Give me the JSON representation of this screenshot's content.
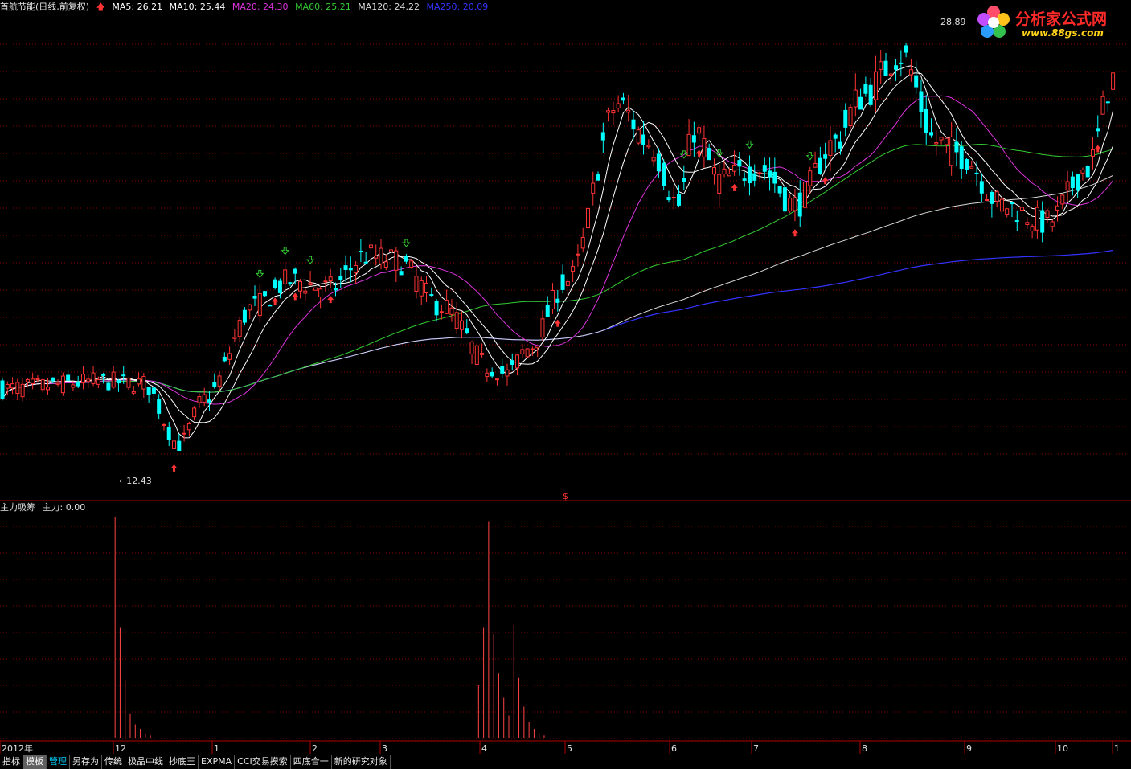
{
  "header": {
    "title": "首航节能(日线,前复权)",
    "ma5": "MA5: 26.21",
    "ma10": "MA10: 25.44",
    "ma20": "MA20: 24.30",
    "ma60": "MA60: 25.21",
    "ma120": "MA120: 24.22",
    "ma250": "MA250: 20.09"
  },
  "colors": {
    "ma5": "#ffffff",
    "ma10": "#ffffff",
    "ma20": "#dd33dd",
    "ma60": "#33cc33",
    "ma120": "#d8d8d8",
    "ma250": "#3333ff",
    "up": "#ff3333",
    "down": "#00ffff",
    "grid": "#8b0000"
  },
  "annotations": {
    "high": "28.89",
    "low": "12.43",
    "marker": "$"
  },
  "sub_panel": {
    "name": "主力吸筹",
    "value": "主力: 0.00"
  },
  "x_axis": [
    "2012年",
    "12",
    "1",
    "2",
    "3",
    "4",
    "5",
    "6",
    "7",
    "8",
    "9",
    "10",
    "1"
  ],
  "tabs": [
    "指标",
    "模板",
    "管理",
    "另存为",
    "传统",
    "极品中线",
    "抄底王",
    "EXPMA",
    "CCI交易摸索",
    "四底合一",
    "新的研究对象"
  ],
  "logo": {
    "text": "分析家公式网",
    "url": "www.88gs.com"
  },
  "chart_data": {
    "type": "candlestick",
    "price_range": [
      11.5,
      30
    ],
    "waypoints_days": [
      0,
      20,
      28,
      35,
      40,
      50,
      57,
      65,
      72,
      78,
      87,
      97,
      100,
      104,
      112,
      122,
      128,
      134,
      137,
      142,
      150,
      157,
      165,
      170,
      178,
      185,
      190,
      198,
      207,
      215,
      220
    ],
    "waypoints_price": [
      15.2,
      15.5,
      15.4,
      13.0,
      14.8,
      18.5,
      19.5,
      19.2,
      20.5,
      20.3,
      18.5,
      16.0,
      15.8,
      16.8,
      19.5,
      26.5,
      25.0,
      22.5,
      25.5,
      23.5,
      24.0,
      22.5,
      25.0,
      26.8,
      28.5,
      25.0,
      24.5,
      22.5,
      21.8,
      24.0,
      27.5
    ],
    "sub_panel_bars": [
      {
        "day": 22,
        "value": 1.0
      },
      {
        "day": 23,
        "value": 0.5
      },
      {
        "day": 24,
        "value": 0.26
      },
      {
        "day": 25,
        "value": 0.11
      },
      {
        "day": 26,
        "value": 0.06
      },
      {
        "day": 27,
        "value": 0.04
      },
      {
        "day": 28,
        "value": 0.02
      },
      {
        "day": 29,
        "value": 0.01
      },
      {
        "day": 94,
        "value": 0.24
      },
      {
        "day": 95,
        "value": 0.5
      },
      {
        "day": 96,
        "value": 0.98
      },
      {
        "day": 97,
        "value": 0.47
      },
      {
        "day": 98,
        "value": 0.29
      },
      {
        "day": 99,
        "value": 0.18
      },
      {
        "day": 100,
        "value": 0.1
      },
      {
        "day": 101,
        "value": 0.51
      },
      {
        "day": 102,
        "value": 0.27
      },
      {
        "day": 103,
        "value": 0.14
      },
      {
        "day": 104,
        "value": 0.07
      },
      {
        "day": 105,
        "value": 0.04
      },
      {
        "day": 106,
        "value": 0.02
      },
      {
        "day": 107,
        "value": 0.01
      }
    ]
  }
}
